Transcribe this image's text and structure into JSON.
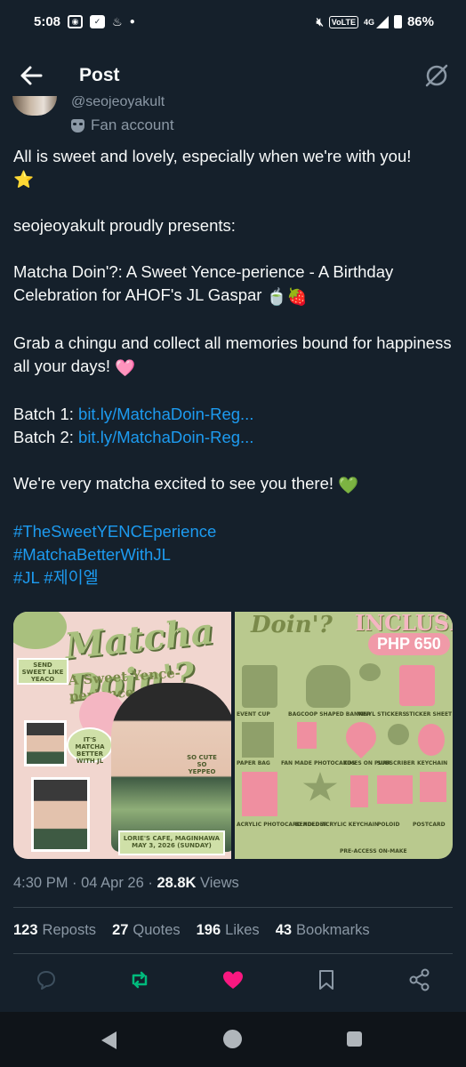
{
  "status_bar": {
    "time": "5:08",
    "network": "4G",
    "volte": "VoLTE",
    "battery": "86%"
  },
  "header": {
    "title": "Post"
  },
  "author": {
    "handle": "@seojeoyakult",
    "label": "Fan account"
  },
  "tweet": {
    "line1": "All is sweet and lovely, especially when we're with you!",
    "star": "⭐",
    "presents": "seojeoyakult proudly presents:",
    "event_title": "Matcha Doin'?: A Sweet Yence-perience - A Birthday Celebration for AHOF's JL Gaspar",
    "event_emoji": "🍵🍓",
    "grab": "Grab a chingu and collect all memories bound for happiness all your days!",
    "grab_emoji": "🩷",
    "batch1_label": "Batch 1:",
    "batch1_link": "bit.ly/MatchaDoin-Reg...",
    "batch2_label": "Batch 2:",
    "batch2_link": "bit.ly/MatchaDoin-Reg...",
    "excited": "We're very matcha excited to see you there!",
    "excited_emoji": "💚",
    "hashtag1": "#TheSweetYENCEperience",
    "hashtag2": "#MatchaBetterWithJL",
    "hashtag3": "#JL",
    "hashtag4": "#제이엘"
  },
  "media": {
    "left": {
      "title": "Matcha Doin'?",
      "subtitle": "A Sweet Yence-perience",
      "note1": "SEND SWEET LIKE YEACO",
      "note2": "IT'S MATCHA BETTER WITH JL",
      "note3": "SO CUTE SO YEPPEO",
      "note4": "LORIE'S CAFE, MAGINHAWA MAY 3, 2026 (SUNDAY)"
    },
    "right": {
      "doin": "Doin'?",
      "inclusions": "INCLUSIONS",
      "price": "PHP 650",
      "captions": [
        "EVENT CUP",
        "BAGCOOP SHAPED BANNER",
        "VINYL STICKERS",
        "STICKER SHEET",
        "PAPER BAG",
        "FAN MADE PHOTOCARDS",
        "TIMES ON PURR",
        "SUBSCRIBER",
        "KEYCHAIN",
        "ACRYLIC PHOTOCARD HOLDER",
        "BEADED ACRYLIC KEYCHAIN",
        "POLOID",
        "POSTCARD",
        "PRE-ACCESS ON-MAKE"
      ]
    }
  },
  "meta": {
    "time": "4:30 PM",
    "sep": " · ",
    "date": "04 Apr 26",
    "views_count": "28.8K",
    "views_label": " Views"
  },
  "stats": {
    "reposts_count": "123",
    "reposts_label": "Reposts",
    "quotes_count": "27",
    "quotes_label": "Quotes",
    "likes_count": "196",
    "likes_label": "Likes",
    "bookmarks_count": "43",
    "bookmarks_label": "Bookmarks"
  },
  "colors": {
    "background": "#15202b",
    "link": "#1d9bf0",
    "repost_active": "#00ba7c",
    "like_active": "#f91880",
    "muted": "#8b98a5"
  }
}
